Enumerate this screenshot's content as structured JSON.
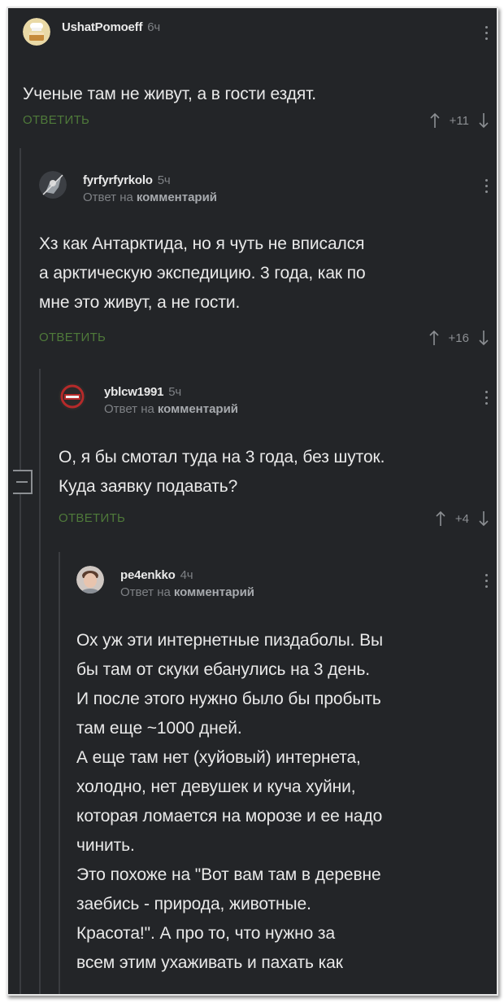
{
  "reply_label": "ОТВЕТИТЬ",
  "reply_to_label": "Ответ на",
  "reply_to_target": "комментарий",
  "comments": [
    {
      "author": "UshatPomoeff",
      "time": "6ч",
      "text": "Ученые там не живут, а в гости ездят.",
      "rating": "+11",
      "avatar_icon": "chef-cake-avatar"
    },
    {
      "author": "fyrfyrfyrkolo",
      "time": "5ч",
      "text": "Хз как Антарктида, но я чуть не вписался\nа арктическую экспедицию. 3 года, как по\nмне это живут, а не гости.",
      "rating": "+16",
      "avatar_icon": "warrior-avatar"
    },
    {
      "author": "yblcw1991",
      "time": "5ч",
      "text": "О, я бы смотал туда на 3 года, без шуток.\nКуда заявку подавать?",
      "rating": "+4",
      "avatar_icon": "badge-logo-avatar"
    },
    {
      "author": "pe4enkko",
      "time": "4ч",
      "text": "Ох уж эти интернетные пиздаболы. Вы\nбы там от скуки ебанулись на 3 день.\nИ после этого нужно было бы пробыть\nтам еще ~1000 дней.\nА еще там нет (хуйовый) интернета,\nхолодно, нет девушек и куча хуйни,\nкоторая ломается на морозе и ее надо\nчинить.\nЭто похоже на \"Вот вам там в деревне\nзаебись - природа, животные.\nКрасота!\". А про то, что нужно за\nвсем этим ухаживать и пахать как",
      "avatar_icon": "person-photo-avatar"
    }
  ],
  "colors": {
    "background": "#232528",
    "text": "#e9e9e9",
    "muted": "#7e8185",
    "reply_green": "#4f7a3a"
  }
}
